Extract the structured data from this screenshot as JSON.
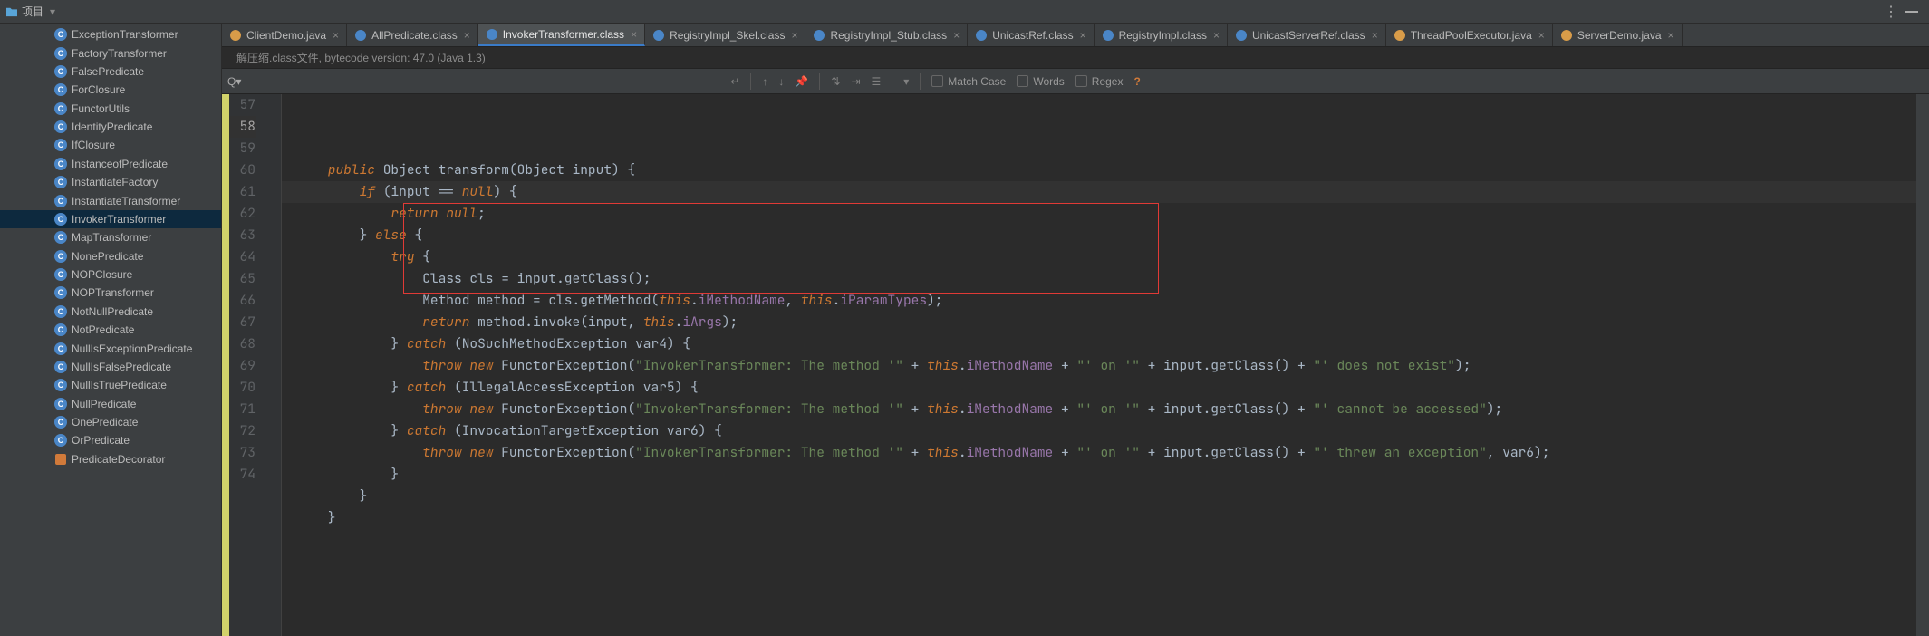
{
  "header": {
    "project_label": "项目"
  },
  "sidebar": {
    "items": [
      {
        "label": "ExceptionTransformer",
        "kind": "class"
      },
      {
        "label": "FactoryTransformer",
        "kind": "class"
      },
      {
        "label": "FalsePredicate",
        "kind": "class"
      },
      {
        "label": "ForClosure",
        "kind": "class"
      },
      {
        "label": "FunctorUtils",
        "kind": "class"
      },
      {
        "label": "IdentityPredicate",
        "kind": "class"
      },
      {
        "label": "IfClosure",
        "kind": "class"
      },
      {
        "label": "InstanceofPredicate",
        "kind": "class"
      },
      {
        "label": "InstantiateFactory",
        "kind": "class"
      },
      {
        "label": "InstantiateTransformer",
        "kind": "class"
      },
      {
        "label": "InvokerTransformer",
        "kind": "class",
        "selected": true
      },
      {
        "label": "MapTransformer",
        "kind": "class"
      },
      {
        "label": "NonePredicate",
        "kind": "class"
      },
      {
        "label": "NOPClosure",
        "kind": "class"
      },
      {
        "label": "NOPTransformer",
        "kind": "class"
      },
      {
        "label": "NotNullPredicate",
        "kind": "class"
      },
      {
        "label": "NotPredicate",
        "kind": "class"
      },
      {
        "label": "NullIsExceptionPredicate",
        "kind": "class"
      },
      {
        "label": "NullIsFalsePredicate",
        "kind": "class"
      },
      {
        "label": "NullIsTruePredicate",
        "kind": "class"
      },
      {
        "label": "NullPredicate",
        "kind": "class"
      },
      {
        "label": "OnePredicate",
        "kind": "class"
      },
      {
        "label": "OrPredicate",
        "kind": "class"
      },
      {
        "label": "PredicateDecorator",
        "kind": "decorator"
      }
    ]
  },
  "tabs": [
    {
      "label": "ClientDemo.java",
      "kind": "java",
      "active": false
    },
    {
      "label": "AllPredicate.class",
      "kind": "class",
      "active": false
    },
    {
      "label": "InvokerTransformer.class",
      "kind": "class",
      "active": true
    },
    {
      "label": "RegistryImpl_Skel.class",
      "kind": "class",
      "active": false
    },
    {
      "label": "RegistryImpl_Stub.class",
      "kind": "class",
      "active": false
    },
    {
      "label": "UnicastRef.class",
      "kind": "class",
      "active": false
    },
    {
      "label": "RegistryImpl.class",
      "kind": "class",
      "active": false
    },
    {
      "label": "UnicastServerRef.class",
      "kind": "class",
      "active": false
    },
    {
      "label": "ThreadPoolExecutor.java",
      "kind": "java",
      "active": false
    },
    {
      "label": "ServerDemo.java",
      "kind": "java",
      "active": false
    }
  ],
  "banner": {
    "text": "解压缩.class文件, bytecode version: 47.0 (Java 1.3)"
  },
  "search": {
    "query_label": "Q▾",
    "placeholder": "",
    "match_case_label": "Match Case",
    "words_label": "Words",
    "regex_label": "Regex",
    "question": "?"
  },
  "gutter": {
    "start": 57,
    "end": 74,
    "highlighted": 58
  },
  "code": {
    "lines": [
      {
        "n": 57,
        "tokens": [
          {
            "t": "    "
          },
          {
            "t": "public",
            "c": "kw"
          },
          {
            "t": " Object transform(Object input) {",
            "c": "cls"
          }
        ]
      },
      {
        "n": 58,
        "hl": true,
        "tokens": [
          {
            "t": "        "
          },
          {
            "t": "if",
            "c": "kw"
          },
          {
            "t": " (input == ",
            "c": "cls"
          },
          {
            "t": "null",
            "c": "kw"
          },
          {
            "t": ") {",
            "c": "cls"
          }
        ]
      },
      {
        "n": 59,
        "tokens": [
          {
            "t": "            "
          },
          {
            "t": "return",
            "c": "kw"
          },
          {
            "t": " ",
            "c": "cls"
          },
          {
            "t": "null",
            "c": "kw"
          },
          {
            "t": ";",
            "c": "cls"
          }
        ]
      },
      {
        "n": 60,
        "tokens": [
          {
            "t": "        } ",
            "c": "cls"
          },
          {
            "t": "else",
            "c": "kw"
          },
          {
            "t": " {",
            "c": "cls"
          }
        ]
      },
      {
        "n": 61,
        "tokens": [
          {
            "t": "            "
          },
          {
            "t": "try",
            "c": "kw"
          },
          {
            "t": " {",
            "c": "cls"
          }
        ]
      },
      {
        "n": 62,
        "tokens": [
          {
            "t": "                Class cls = input.getClass();",
            "c": "cls"
          }
        ]
      },
      {
        "n": 63,
        "tokens": [
          {
            "t": "                Method method = cls.getMethod(",
            "c": "cls"
          },
          {
            "t": "this",
            "c": "this"
          },
          {
            "t": ".",
            "c": "cls"
          },
          {
            "t": "iMethodName",
            "c": "field"
          },
          {
            "t": ", ",
            "c": "cls"
          },
          {
            "t": "this",
            "c": "this"
          },
          {
            "t": ".",
            "c": "cls"
          },
          {
            "t": "iParamTypes",
            "c": "field"
          },
          {
            "t": ");",
            "c": "cls"
          }
        ]
      },
      {
        "n": 64,
        "tokens": [
          {
            "t": "                "
          },
          {
            "t": "return",
            "c": "kw"
          },
          {
            "t": " method.invoke(input, ",
            "c": "cls"
          },
          {
            "t": "this",
            "c": "this"
          },
          {
            "t": ".",
            "c": "cls"
          },
          {
            "t": "iArgs",
            "c": "field"
          },
          {
            "t": ");",
            "c": "cls"
          }
        ]
      },
      {
        "n": 65,
        "tokens": [
          {
            "t": "            } ",
            "c": "cls"
          },
          {
            "t": "catch",
            "c": "kw"
          },
          {
            "t": " (NoSuchMethodException var4) {",
            "c": "cls"
          }
        ]
      },
      {
        "n": 66,
        "tokens": [
          {
            "t": "                "
          },
          {
            "t": "throw",
            "c": "kw"
          },
          {
            "t": " ",
            "c": "cls"
          },
          {
            "t": "new",
            "c": "kw"
          },
          {
            "t": " FunctorException(",
            "c": "cls"
          },
          {
            "t": "\"InvokerTransformer: The method '\"",
            "c": "str"
          },
          {
            "t": " + ",
            "c": "cls"
          },
          {
            "t": "this",
            "c": "this"
          },
          {
            "t": ".",
            "c": "cls"
          },
          {
            "t": "iMethodName",
            "c": "field"
          },
          {
            "t": " + ",
            "c": "cls"
          },
          {
            "t": "\"' on '\"",
            "c": "str"
          },
          {
            "t": " + input.getClass() + ",
            "c": "cls"
          },
          {
            "t": "\"' does not exist\"",
            "c": "str"
          },
          {
            "t": ");",
            "c": "cls"
          }
        ]
      },
      {
        "n": 67,
        "tokens": [
          {
            "t": "            } ",
            "c": "cls"
          },
          {
            "t": "catch",
            "c": "kw"
          },
          {
            "t": " (IllegalAccessException var5) {",
            "c": "cls"
          }
        ]
      },
      {
        "n": 68,
        "tokens": [
          {
            "t": "                "
          },
          {
            "t": "throw",
            "c": "kw"
          },
          {
            "t": " ",
            "c": "cls"
          },
          {
            "t": "new",
            "c": "kw"
          },
          {
            "t": " FunctorException(",
            "c": "cls"
          },
          {
            "t": "\"InvokerTransformer: The method '\"",
            "c": "str"
          },
          {
            "t": " + ",
            "c": "cls"
          },
          {
            "t": "this",
            "c": "this"
          },
          {
            "t": ".",
            "c": "cls"
          },
          {
            "t": "iMethodName",
            "c": "field"
          },
          {
            "t": " + ",
            "c": "cls"
          },
          {
            "t": "\"' on '\"",
            "c": "str"
          },
          {
            "t": " + input.getClass() + ",
            "c": "cls"
          },
          {
            "t": "\"' cannot be accessed\"",
            "c": "str"
          },
          {
            "t": ");",
            "c": "cls"
          }
        ]
      },
      {
        "n": 69,
        "tokens": [
          {
            "t": "            } ",
            "c": "cls"
          },
          {
            "t": "catch",
            "c": "kw"
          },
          {
            "t": " (InvocationTargetException var6) {",
            "c": "cls"
          }
        ]
      },
      {
        "n": 70,
        "tokens": [
          {
            "t": "                "
          },
          {
            "t": "throw",
            "c": "kw"
          },
          {
            "t": " ",
            "c": "cls"
          },
          {
            "t": "new",
            "c": "kw"
          },
          {
            "t": " FunctorException(",
            "c": "cls"
          },
          {
            "t": "\"InvokerTransformer: The method '\"",
            "c": "str"
          },
          {
            "t": " + ",
            "c": "cls"
          },
          {
            "t": "this",
            "c": "this"
          },
          {
            "t": ".",
            "c": "cls"
          },
          {
            "t": "iMethodName",
            "c": "field"
          },
          {
            "t": " + ",
            "c": "cls"
          },
          {
            "t": "\"' on '\"",
            "c": "str"
          },
          {
            "t": " + input.getClass() + ",
            "c": "cls"
          },
          {
            "t": "\"' threw an exception\"",
            "c": "str"
          },
          {
            "t": ", var6);",
            "c": "cls"
          }
        ]
      },
      {
        "n": 71,
        "tokens": [
          {
            "t": "            }",
            "c": "cls"
          }
        ]
      },
      {
        "n": 72,
        "tokens": [
          {
            "t": "        }",
            "c": "cls"
          }
        ]
      },
      {
        "n": 73,
        "tokens": [
          {
            "t": "    }",
            "c": "cls"
          }
        ]
      },
      {
        "n": 74,
        "tokens": [
          {
            "t": "",
            "c": "cls"
          }
        ]
      }
    ]
  }
}
